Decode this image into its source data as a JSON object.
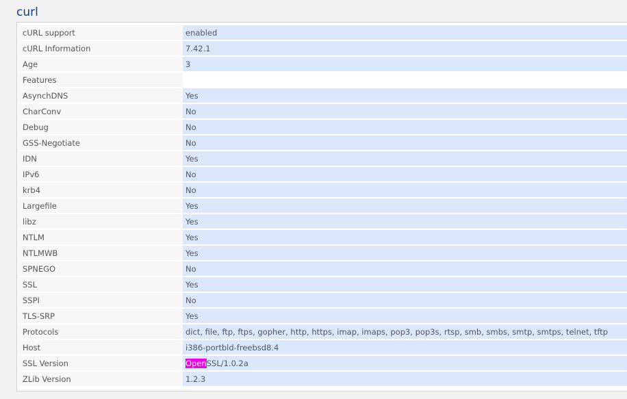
{
  "title": "curl",
  "rows": [
    {
      "label": "cURL support",
      "value": "enabled"
    },
    {
      "label": "cURL Information",
      "value": "7.42.1"
    },
    {
      "label": "Age",
      "value": "3"
    },
    {
      "label": "Features",
      "value": ""
    },
    {
      "label": "AsynchDNS",
      "value": "Yes"
    },
    {
      "label": "CharConv",
      "value": "No"
    },
    {
      "label": "Debug",
      "value": "No"
    },
    {
      "label": "GSS-Negotiate",
      "value": "No"
    },
    {
      "label": "IDN",
      "value": "Yes"
    },
    {
      "label": "IPv6",
      "value": "No"
    },
    {
      "label": "krb4",
      "value": "No"
    },
    {
      "label": "Largefile",
      "value": "Yes"
    },
    {
      "label": "libz",
      "value": "Yes"
    },
    {
      "label": "NTLM",
      "value": "Yes"
    },
    {
      "label": "NTLMWB",
      "value": "Yes"
    },
    {
      "label": "SPNEGO",
      "value": "No"
    },
    {
      "label": "SSL",
      "value": "Yes"
    },
    {
      "label": "SSPI",
      "value": "No"
    },
    {
      "label": "TLS-SRP",
      "value": "Yes"
    },
    {
      "label": "Protocols",
      "value": "dict, file, ftp, ftps, gopher, http, https, imap, imaps, pop3, pop3s, rtsp, smb, smbs, smtp, smtps, telnet, tftp"
    },
    {
      "label": "Host",
      "value": "i386-portbld-freebsd8.4"
    },
    {
      "label": "SSL Version",
      "value_highlight": "Open",
      "value": "SSL/1.0.2a"
    },
    {
      "label": "ZLib Version",
      "value": "1.2.3"
    }
  ]
}
